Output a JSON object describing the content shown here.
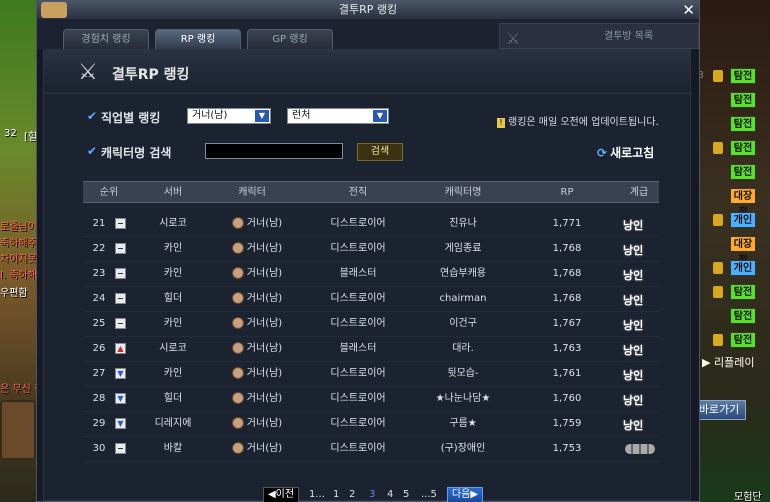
{
  "window": {
    "title": "결투RP 랭킹",
    "close_label": "✕"
  },
  "tabs": [
    {
      "label": "경험치 랭킹",
      "active": false
    },
    {
      "label": "RP 랭킹",
      "active": true
    },
    {
      "label": "GP 랭킹",
      "active": false
    }
  ],
  "duel_room_list_label": "결투방 목록",
  "panel_title": "결투RP 랭킹",
  "filter": {
    "job_rank_label": "직업별 랭킹",
    "job_select_value": "거너(남)",
    "sub_select_value": "런처",
    "char_search_label": "캐릭터명 검색",
    "search_button": "검색",
    "refresh_button": "새로고침",
    "notice": "랭킹은 매일 오전에 업데이트됩니다."
  },
  "table": {
    "headers": [
      "순위",
      "서버",
      "캐릭터",
      "전직",
      "캐릭터명",
      "RP",
      "계급"
    ],
    "rows": [
      {
        "rank": "21",
        "change": "same",
        "server": "시로코",
        "job": "거너(남)",
        "class": "디스트로이어",
        "name": "진유나",
        "rp": "1,771",
        "grade": "낭인"
      },
      {
        "rank": "22",
        "change": "same",
        "server": "카인",
        "job": "거너(남)",
        "class": "디스트로이어",
        "name": "게임종료",
        "rp": "1,768",
        "grade": "낭인"
      },
      {
        "rank": "23",
        "change": "same",
        "server": "카인",
        "job": "거너(남)",
        "class": "블래스터",
        "name": "연습부캐용",
        "rp": "1,768",
        "grade": "낭인"
      },
      {
        "rank": "24",
        "change": "same",
        "server": "힐더",
        "job": "거너(남)",
        "class": "디스트로이어",
        "name": "chairman",
        "rp": "1,768",
        "grade": "낭인"
      },
      {
        "rank": "25",
        "change": "same",
        "server": "카인",
        "job": "거너(남)",
        "class": "디스트로이어",
        "name": "이건구",
        "rp": "1,767",
        "grade": "낭인"
      },
      {
        "rank": "26",
        "change": "up",
        "server": "시로코",
        "job": "거너(남)",
        "class": "블래스터",
        "name": "대라.",
        "rp": "1,763",
        "grade": "낭인"
      },
      {
        "rank": "27",
        "change": "down",
        "server": "카인",
        "job": "거너(남)",
        "class": "디스트로이어",
        "name": "뒷모습-",
        "rp": "1,761",
        "grade": "낭인"
      },
      {
        "rank": "28",
        "change": "down",
        "server": "힐더",
        "job": "거너(남)",
        "class": "디스트로이어",
        "name": "★나눈나담★",
        "rp": "1,760",
        "grade": "낭인"
      },
      {
        "rank": "29",
        "change": "down",
        "server": "디레지에",
        "job": "거너(남)",
        "class": "디스트로이어",
        "name": "구름★",
        "rp": "1,759",
        "grade": "낭인"
      },
      {
        "rank": "30",
        "change": "same",
        "server": "바칼",
        "job": "거너(남)",
        "class": "디스트로이어",
        "name": "(구)장애인",
        "rp": "1,753",
        "grade": ""
      }
    ]
  },
  "pager": {
    "prev": "이전",
    "next": "다음",
    "first": "1...",
    "pages": [
      "1",
      "2",
      "3",
      "4",
      "5"
    ],
    "current": "3",
    "last": "...5"
  },
  "right_side": {
    "tags": [
      "탐전",
      "탐전",
      "탐전",
      "탐전",
      "탐전",
      "대장전",
      "개인",
      "대장전",
      "개인",
      "탐전",
      "탐전",
      "탐전"
    ],
    "replay": "리플레이",
    "goto": "바로가기",
    "recruit": "모험단"
  },
  "left_side": {
    "badge": "32",
    "texts": [
      "[힐더",
      "로줄님이 E",
      "축하해주",
      "차이지못드",
      "I. 축하해",
      "우편함",
      "은 무신 집호"
    ]
  }
}
